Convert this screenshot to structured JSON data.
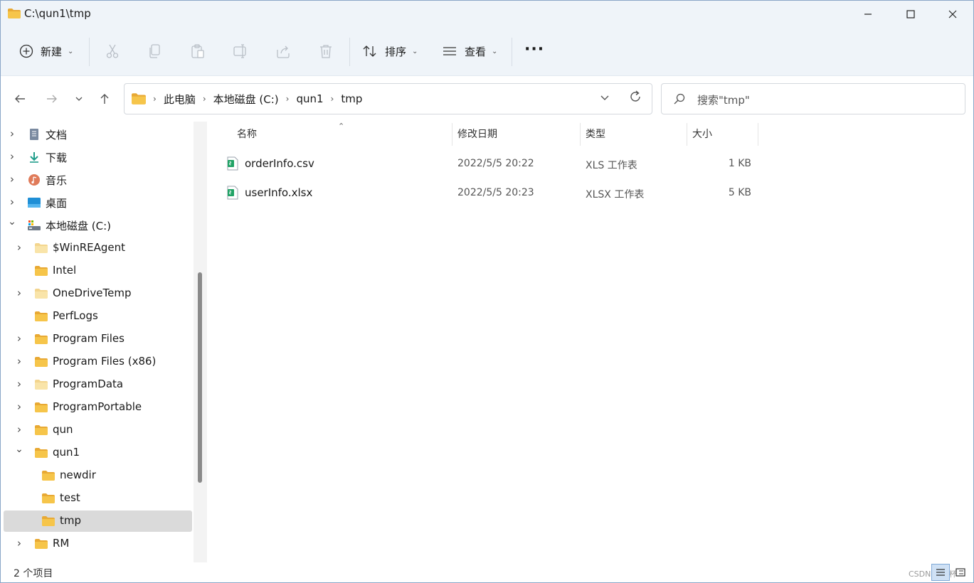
{
  "window": {
    "title": "C:\\qun1\\tmp",
    "controls": {
      "minimize": "—",
      "maximize": "☐",
      "close": "✕"
    }
  },
  "toolbar": {
    "new_label": "新建",
    "sort_label": "排序",
    "view_label": "查看",
    "more_label": "···",
    "icons": [
      "cut-icon",
      "copy-icon",
      "paste-icon",
      "rename-icon",
      "share-icon",
      "delete-icon"
    ]
  },
  "address": {
    "crumbs": [
      "此电脑",
      "本地磁盘 (C:)",
      "qun1",
      "tmp"
    ],
    "separator": "›"
  },
  "search": {
    "placeholder": "搜索\"tmp\""
  },
  "sidebar": {
    "items": [
      {
        "label": "文档",
        "icon": "documents-icon",
        "expand": "›",
        "level": 0
      },
      {
        "label": "下载",
        "icon": "download-icon",
        "expand": "›",
        "level": 0
      },
      {
        "label": "音乐",
        "icon": "music-icon",
        "expand": "›",
        "level": 0
      },
      {
        "label": "桌面",
        "icon": "desktop-icon",
        "expand": "›",
        "level": 0
      },
      {
        "label": "本地磁盘 (C:)",
        "icon": "drive-icon",
        "expand": "⌄",
        "level": 0
      },
      {
        "label": "$WinREAgent",
        "icon": "folder-light-icon",
        "expand": "›",
        "level": 1
      },
      {
        "label": "Intel",
        "icon": "folder-icon",
        "expand": "",
        "level": 1
      },
      {
        "label": "OneDriveTemp",
        "icon": "folder-light-icon",
        "expand": "›",
        "level": 1
      },
      {
        "label": "PerfLogs",
        "icon": "folder-icon",
        "expand": "",
        "level": 1
      },
      {
        "label": "Program Files",
        "icon": "folder-icon",
        "expand": "›",
        "level": 1
      },
      {
        "label": "Program Files (x86)",
        "icon": "folder-icon",
        "expand": "›",
        "level": 1
      },
      {
        "label": "ProgramData",
        "icon": "folder-light-icon",
        "expand": "›",
        "level": 1
      },
      {
        "label": "ProgramPortable",
        "icon": "folder-icon",
        "expand": "›",
        "level": 1
      },
      {
        "label": "qun",
        "icon": "folder-icon",
        "expand": "›",
        "level": 1
      },
      {
        "label": "qun1",
        "icon": "folder-icon",
        "expand": "⌄",
        "level": 1
      },
      {
        "label": "newdir",
        "icon": "folder-icon",
        "expand": "",
        "level": 2
      },
      {
        "label": "test",
        "icon": "folder-icon",
        "expand": "",
        "level": 2
      },
      {
        "label": "tmp",
        "icon": "folder-icon",
        "expand": "",
        "level": 2,
        "selected": true
      },
      {
        "label": "RM",
        "icon": "folder-icon",
        "expand": "›",
        "level": 1
      }
    ]
  },
  "table": {
    "headers": {
      "name": "名称",
      "modified": "修改日期",
      "type": "类型",
      "size": "大小"
    },
    "sort_indicator": "⌃",
    "rows": [
      {
        "name": "orderInfo.csv",
        "modified": "2022/5/5 20:22",
        "type": "XLS 工作表",
        "size": "1 KB"
      },
      {
        "name": "userInfo.xlsx",
        "modified": "2022/5/5 20:23",
        "type": "XLSX 工作表",
        "size": "5 KB"
      }
    ]
  },
  "status": {
    "count_text": "2 个项目",
    "watermark": "CSDN @来杯"
  },
  "colors": {
    "chrome_bg": "#eff4f9",
    "folder": "#f4c542",
    "excel_green": "#21a366",
    "selected_bg": "#dadada"
  }
}
